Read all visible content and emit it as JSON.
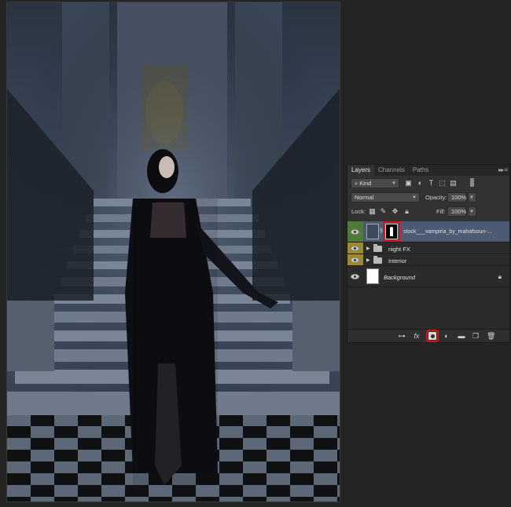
{
  "panel": {
    "tabs": [
      {
        "label": "Layers",
        "active": true
      },
      {
        "label": "Channels",
        "active": false
      },
      {
        "label": "Paths",
        "active": false
      }
    ],
    "menu_icon": "double-chevron-menu-icon",
    "filter_kind": "Kind",
    "blend_mode": "Normal",
    "opacity_label": "Opacity:",
    "opacity_value": "100%",
    "lock_label": "Lock:",
    "fill_label": "Fill:",
    "fill_value": "100%",
    "layers": [
      {
        "name": "stock___vampiria_by_mahafsoun-...",
        "type": "smart-object-with-mask",
        "visible": true,
        "selected": true,
        "eye_color": "#4f7a3a"
      },
      {
        "name": "night FX",
        "type": "group",
        "visible": true,
        "eye_color": "#9f8a2a"
      },
      {
        "name": "Interior",
        "type": "group",
        "visible": true,
        "eye_color": "#9f8a2a"
      },
      {
        "name": "Background",
        "type": "background",
        "visible": true,
        "locked": true
      }
    ],
    "bottom_icons": [
      "link-icon",
      "fx-icon",
      "add-mask-icon",
      "adjustment-icon",
      "new-group-icon",
      "new-layer-icon",
      "trash-icon"
    ],
    "highlight_color": "#e01010"
  }
}
